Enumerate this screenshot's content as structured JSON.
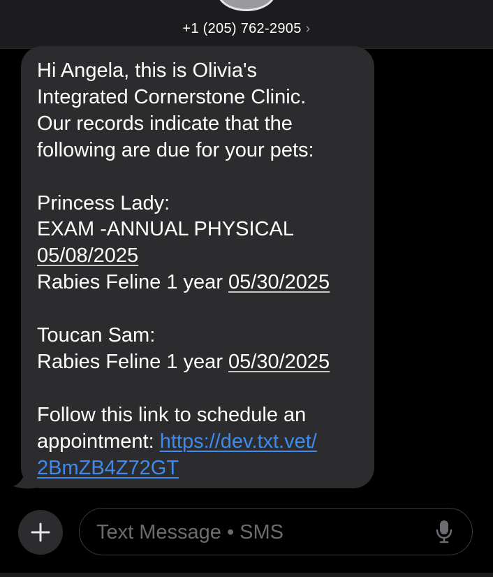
{
  "header": {
    "contact": "+1 (205) 762-2905",
    "chevron": "›"
  },
  "message": {
    "paragraph1": [
      "Hi Angela, this is Olivia's",
      "Integrated Cornerstone Clinic.",
      "Our records indicate that the",
      "following are due for your pets:"
    ],
    "pet1": {
      "name": "Princess Lady:",
      "item1_name": "EXAM -ANNUAL PHYSICAL",
      "item1_date": "05/08/2025",
      "item2_name": "Rabies Feline 1 year ",
      "item2_date": "05/30/2025"
    },
    "pet2": {
      "name": "Toucan Sam:",
      "item1_name": "Rabies Feline 1 year ",
      "item1_date": "05/30/2025"
    },
    "closing": {
      "line1": "Follow this link to schedule an",
      "line2_prefix": "appointment: ",
      "link_part1": "https://dev.txt.vet/",
      "link_part2": "2BmZB4Z72GT"
    }
  },
  "compose": {
    "placeholder": "Text Message • SMS",
    "plus_icon": "plus-icon",
    "mic_icon": "microphone-icon"
  },
  "colors": {
    "bubble": "#2c2c2e",
    "link": "#3d8bf0",
    "background": "#000000"
  }
}
